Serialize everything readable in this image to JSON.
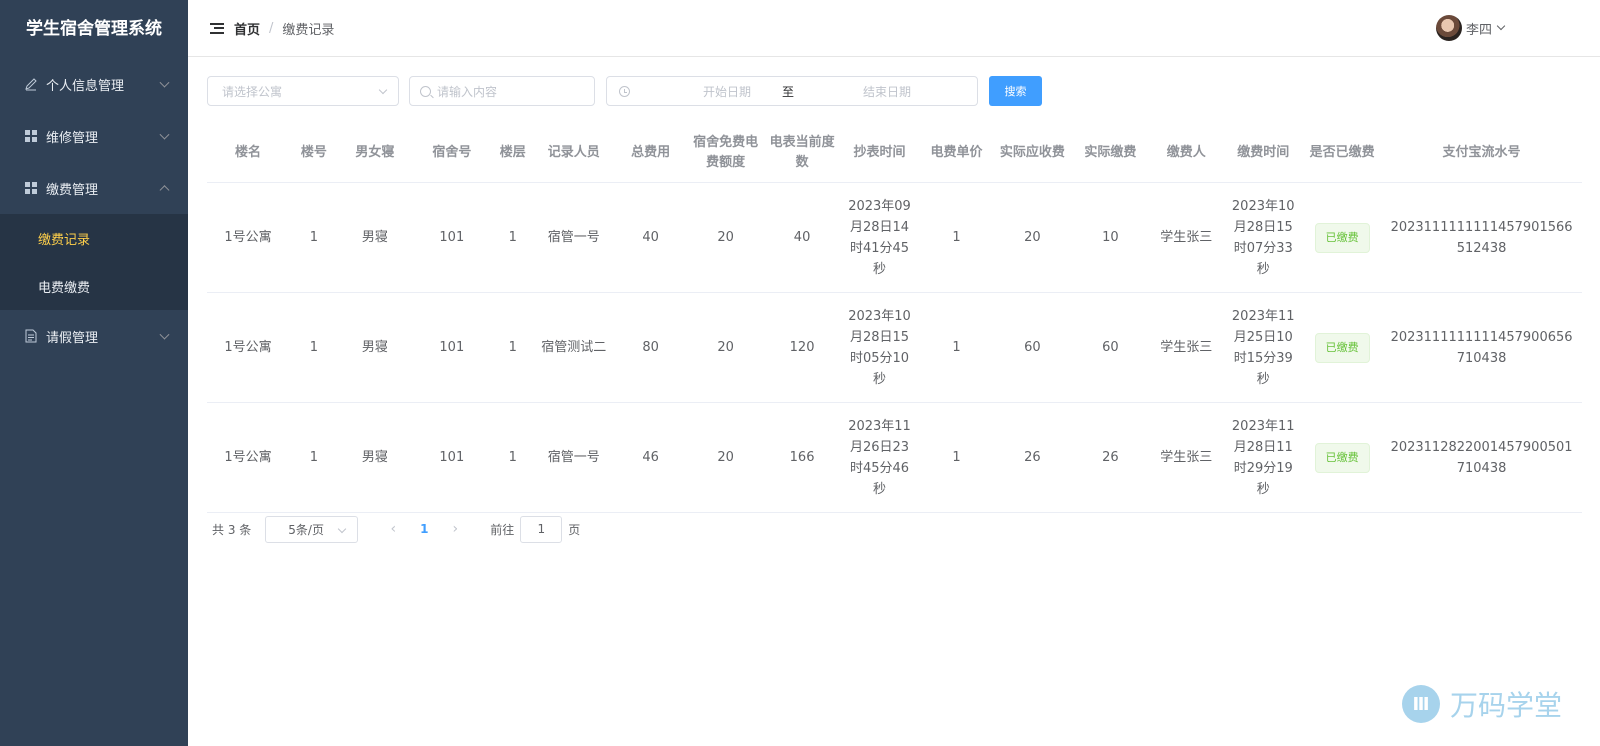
{
  "app": {
    "title": "学生宿舍管理系统"
  },
  "sidebar": {
    "items": [
      {
        "label": "个人信息管理",
        "icon": "edit-icon"
      },
      {
        "label": "维修管理",
        "icon": "grid-icon"
      },
      {
        "label": "缴费管理",
        "icon": "grid-icon",
        "expanded": true
      },
      {
        "label": "请假管理",
        "icon": "document-icon"
      }
    ],
    "subitems": [
      {
        "label": "缴费记录",
        "active": true
      },
      {
        "label": "电费缴费",
        "active": false
      }
    ]
  },
  "header": {
    "breadcrumb": {
      "home": "首页",
      "separator": "/",
      "current": "缴费记录"
    },
    "user": {
      "name": "李四"
    }
  },
  "filters": {
    "apartment_placeholder": "请选择公寓",
    "search_placeholder": "请输入内容",
    "date_start_placeholder": "开始日期",
    "date_to": "至",
    "date_end_placeholder": "结束日期",
    "search_button": "搜索"
  },
  "table": {
    "columns": [
      "楼名",
      "楼号",
      "男女寝",
      "宿舍号",
      "楼层",
      "记录人员",
      "总费用",
      "宿舍免费电费额度",
      "电表当前度数",
      "抄表时间",
      "电费单价",
      "实际应收费",
      "实际缴费",
      "缴费人",
      "缴费时间",
      "是否已缴费",
      "支付宝流水号"
    ],
    "rows": [
      [
        "1号公寓",
        "1",
        "男寝",
        "101",
        "1",
        "宿管一号",
        "40",
        "20",
        "40",
        "2023年09月28日14时41分45秒",
        "1",
        "20",
        "10",
        "学生张三",
        "2023年10月28日15时07分33秒",
        "已缴费",
        "2023111111111457901566512438"
      ],
      [
        "1号公寓",
        "1",
        "男寝",
        "101",
        "1",
        "宿管测试二",
        "80",
        "20",
        "120",
        "2023年10月28日15时05分10秒",
        "1",
        "60",
        "60",
        "学生张三",
        "2023年11月25日10时15分39秒",
        "已缴费",
        "2023111111111457900656710438"
      ],
      [
        "1号公寓",
        "1",
        "男寝",
        "101",
        "1",
        "宿管一号",
        "46",
        "20",
        "166",
        "2023年11月26日23时45分46秒",
        "1",
        "26",
        "26",
        "学生张三",
        "2023年11月28日11时29分19秒",
        "已缴费",
        "2023112822001457900501710438"
      ]
    ]
  },
  "pagination": {
    "total": "共 3 条",
    "page_size": "5条/页",
    "current_page": "1",
    "goto_label": "前往",
    "goto_value": "1",
    "page_suffix": "页"
  },
  "watermark": {
    "logo": "Ⅲ",
    "text": "万码学堂"
  },
  "colors": {
    "sidebar_bg": "#304156",
    "active_menu": "#ffd04b",
    "primary": "#409eff",
    "success": "#67c23a"
  }
}
